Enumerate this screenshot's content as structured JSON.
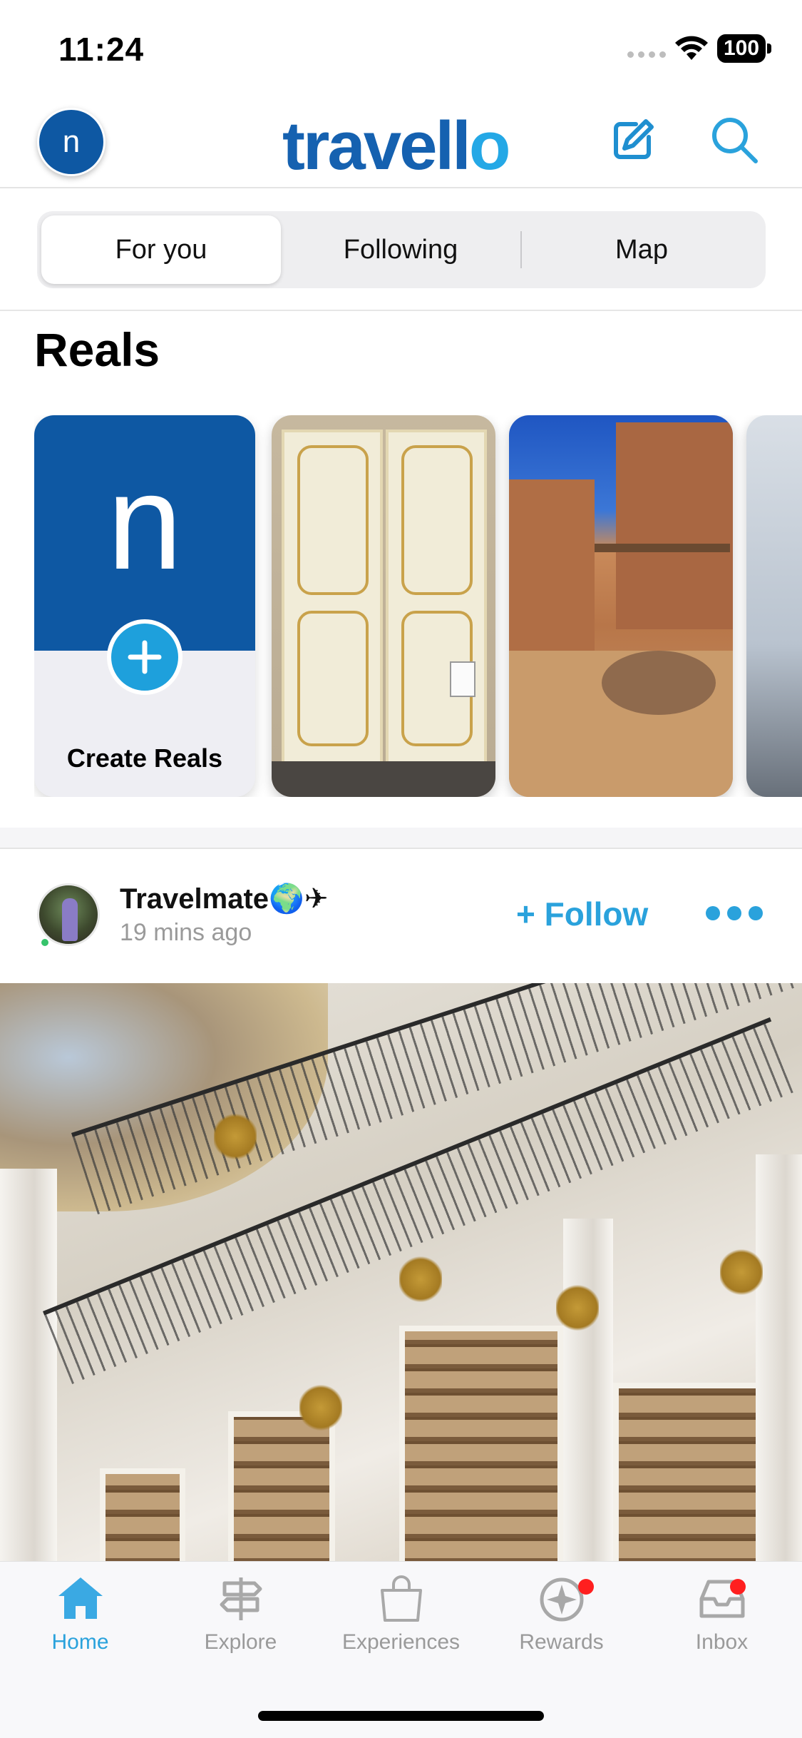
{
  "status_bar": {
    "time": "11:24",
    "battery": "100"
  },
  "header": {
    "avatar_letter": "n",
    "logo": "travello"
  },
  "tabs": [
    {
      "label": "For you",
      "active": true
    },
    {
      "label": "Following",
      "active": false
    },
    {
      "label": "Map",
      "active": false
    }
  ],
  "reals": {
    "title": "Reals",
    "create_letter": "n",
    "create_label": "Create Reals"
  },
  "post": {
    "author": "Travelmate🌍✈",
    "time": "19 mins ago",
    "follow_label": "+ Follow"
  },
  "tab_bar": {
    "items": [
      {
        "label": "Home",
        "icon": "home-icon",
        "active": true
      },
      {
        "label": "Explore",
        "icon": "signpost-icon",
        "active": false
      },
      {
        "label": "Experiences",
        "icon": "bag-icon",
        "active": false
      },
      {
        "label": "Rewards",
        "icon": "rewards-icon",
        "active": false,
        "badge": true
      },
      {
        "label": "Inbox",
        "icon": "inbox-icon",
        "active": false,
        "badge": true
      }
    ]
  },
  "colors": {
    "brand_blue": "#1561b0",
    "accent_cyan": "#2aa2dc",
    "badge_red": "#ff1f1f"
  }
}
